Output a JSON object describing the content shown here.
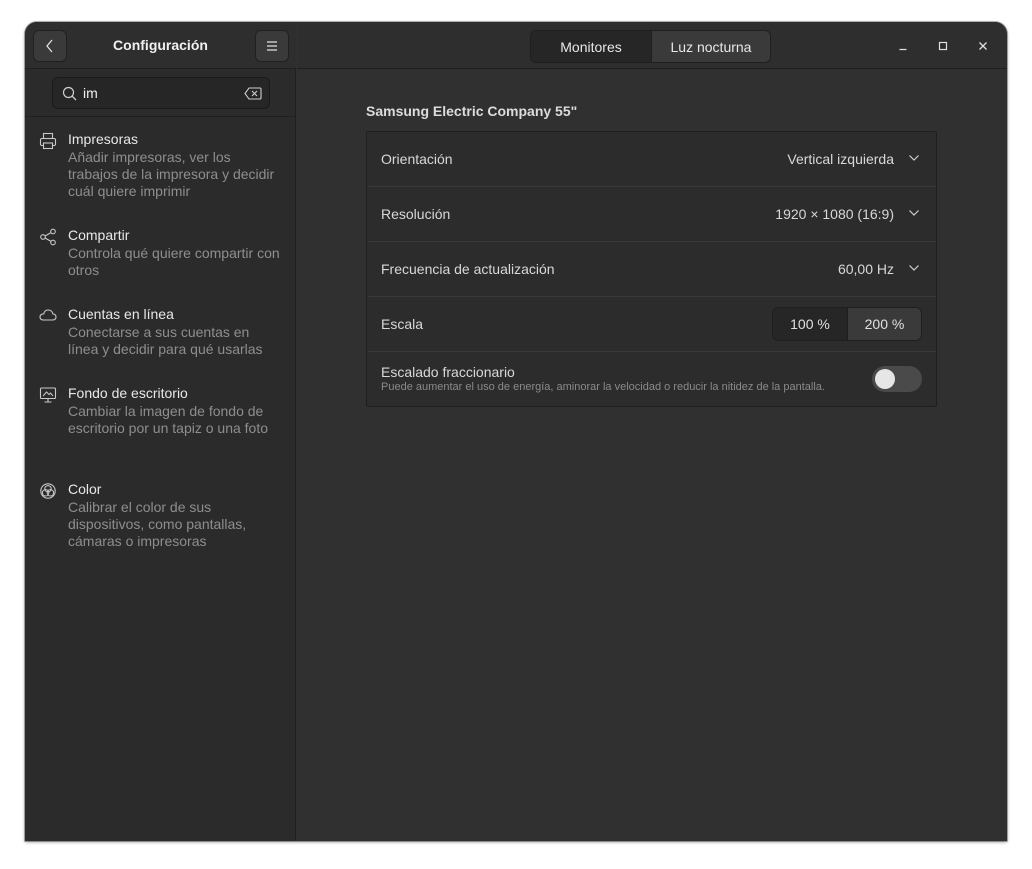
{
  "sidebar": {
    "title": "Configuración",
    "search": {
      "value": "im"
    },
    "results": [
      {
        "title": "Impresoras",
        "description": "Añadir impresoras, ver los trabajos de la impresora y decidir cuál quiere imprimir",
        "icon": "printer-icon"
      },
      {
        "title": "Compartir",
        "description": "Controla qué quiere compartir con otros",
        "icon": "share-icon"
      },
      {
        "title": "Cuentas en línea",
        "description": "Conectarse a sus cuentas en línea y decidir para qué usarlas",
        "icon": "cloud-icon"
      },
      {
        "title": "Fondo de escritorio",
        "description": "Cambiar la imagen de fondo de escritorio por un tapiz o una foto",
        "icon": "desktop-monitor-icon"
      },
      {
        "title": "Color",
        "description": "Calibrar el color de sus dispositivos, como pantallas, cámaras o impresoras",
        "icon": "color-icon"
      }
    ]
  },
  "header": {
    "tabs": [
      {
        "label": "Monitores",
        "active": true
      },
      {
        "label": "Luz nocturna",
        "active": false
      }
    ]
  },
  "display": {
    "monitor_name": "Samsung Electric Company 55\"",
    "orientation": {
      "label": "Orientación",
      "value": "Vertical izquierda"
    },
    "resolution": {
      "label": "Resolución",
      "value": "1920 × 1080 (16:9)"
    },
    "refresh": {
      "label": "Frecuencia de actualización",
      "value": "60,00 Hz"
    },
    "scale": {
      "label": "Escala",
      "options": [
        "100 %",
        "200 %"
      ],
      "selected": "100 %"
    },
    "fractional": {
      "label": "Escalado fraccionario",
      "description": "Puede aumentar el uso de energía, aminorar la velocidad o reducir la nitidez de la pantalla.",
      "enabled": false
    }
  },
  "colors": {
    "window_bg": "#303030",
    "sidebar_bg": "#2b2b2b",
    "panel_bg": "#2c2c2c"
  }
}
